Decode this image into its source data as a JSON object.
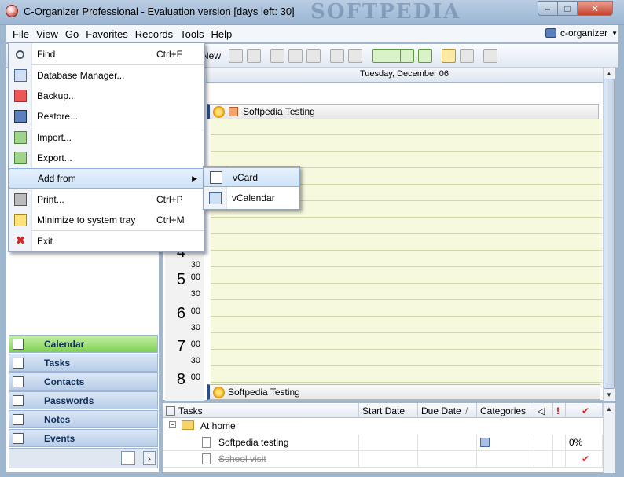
{
  "window": {
    "title": "C-Organizer Professional - Evaluation version [days left: 30]",
    "watermark": "SOFTPEDIA"
  },
  "menubar": [
    "File",
    "View",
    "Go",
    "Favorites",
    "Records",
    "Tools",
    "Help"
  ],
  "profile": {
    "label": "c-organizer",
    "arrow": "▼"
  },
  "toolbar": {
    "new_label": "New"
  },
  "file_menu": [
    {
      "label": "Find",
      "shortcut": "Ctrl+F",
      "icon": "find-icon"
    },
    {
      "label": "Database Manager...",
      "shortcut": "",
      "icon": "database-icon"
    },
    {
      "label": "Backup...",
      "shortcut": "",
      "icon": "backup-icon"
    },
    {
      "label": "Restore...",
      "shortcut": "",
      "icon": "restore-icon"
    },
    {
      "label": "Import...",
      "shortcut": "",
      "icon": "import-icon"
    },
    {
      "label": "Export...",
      "shortcut": "",
      "icon": "export-icon"
    },
    {
      "label": "Add from",
      "shortcut": "",
      "icon": "",
      "submenu": true
    },
    {
      "label": "Print...",
      "shortcut": "Ctrl+P",
      "icon": "print-icon"
    },
    {
      "label": "Minimize to system tray",
      "shortcut": "Ctrl+M",
      "icon": "tray-icon"
    },
    {
      "label": "Exit",
      "shortcut": "",
      "icon": "exit-icon"
    }
  ],
  "add_from_submenu": [
    {
      "label": "vCard",
      "icon": "vcard-icon"
    },
    {
      "label": "vCalendar",
      "icon": "vcalendar-icon"
    }
  ],
  "nav": [
    "Calendar",
    "Tasks",
    "Contacts",
    "Passwords",
    "Notes",
    "Events"
  ],
  "calendar": {
    "day_header": "Tuesday, December 06",
    "hours": [
      {
        "h": "4",
        "m1": "",
        "m2": "30"
      },
      {
        "h": "5",
        "m1": "00",
        "m2": "30"
      },
      {
        "h": "6",
        "m1": "00",
        "m2": "30"
      },
      {
        "h": "7",
        "m1": "00",
        "m2": "30"
      },
      {
        "h": "8",
        "m1": "00",
        "m2": ""
      }
    ],
    "events": [
      {
        "title": "Softpedia Testing"
      },
      {
        "title": "Softpedia Testing"
      }
    ]
  },
  "tasks": {
    "columns": [
      "Tasks",
      "Start Date",
      "Due Date",
      "/",
      "Categories",
      "",
      "!",
      "✔"
    ],
    "group": "At home",
    "rows": [
      {
        "name": "Softpedia testing",
        "progress": "0%",
        "done": false
      },
      {
        "name": "School visit",
        "progress": "",
        "done": true
      }
    ]
  },
  "colors": {
    "nav_active": "#7fd153",
    "event_border": "#2a4b8d",
    "calendar_slot": "#f6f9de"
  }
}
